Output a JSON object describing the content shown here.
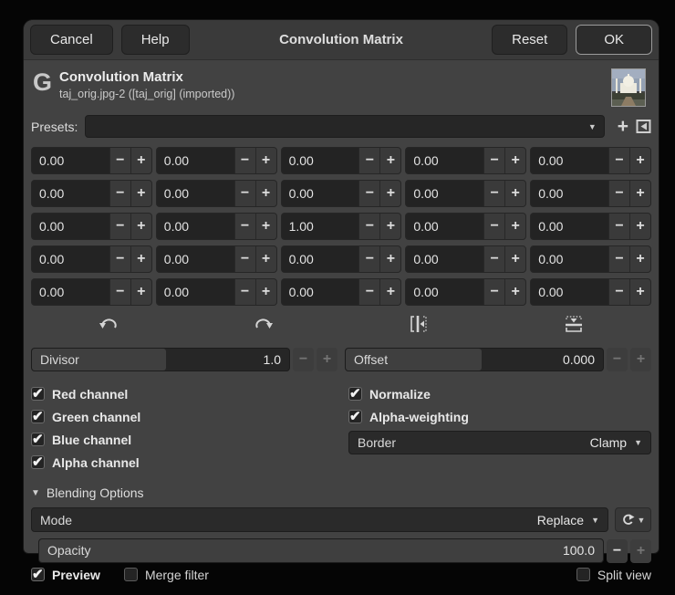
{
  "titlebar": {
    "cancel_label": "Cancel",
    "help_label": "Help",
    "title": "Convolution Matrix",
    "reset_label": "Reset",
    "ok_label": "OK"
  },
  "header": {
    "logo_glyph": "G",
    "title": "Convolution Matrix",
    "subtitle": "taj_orig.jpg-2 ([taj_orig] (imported))",
    "thumbnail": "taj-mahal-preview"
  },
  "presets": {
    "label": "Presets:",
    "value": "",
    "add_button_icon": "plus-icon",
    "add_button_glyph": "+",
    "manage_button_icon": "saved-settings-icon"
  },
  "matrix": {
    "rows": [
      [
        "0.00",
        "0.00",
        "0.00",
        "0.00",
        "0.00"
      ],
      [
        "0.00",
        "0.00",
        "0.00",
        "0.00",
        "0.00"
      ],
      [
        "0.00",
        "0.00",
        "1.00",
        "0.00",
        "0.00"
      ],
      [
        "0.00",
        "0.00",
        "0.00",
        "0.00",
        "0.00"
      ],
      [
        "0.00",
        "0.00",
        "0.00",
        "0.00",
        "0.00"
      ]
    ],
    "minus_glyph": "−",
    "plus_glyph": "+"
  },
  "tools": [
    {
      "name": "rotate-90-ccw"
    },
    {
      "name": "rotate-90-cw"
    },
    {
      "name": "flip-horizontal"
    },
    {
      "name": "flip-vertical"
    }
  ],
  "divisor": {
    "label": "Divisor",
    "value": "1.0",
    "fill_pct": 52,
    "minus_enabled": false,
    "plus_enabled": false
  },
  "offset": {
    "label": "Offset",
    "value": "0.000",
    "fill_pct": 53,
    "minus_enabled": false,
    "plus_enabled": false
  },
  "channels": [
    {
      "label": "Red channel",
      "checked": true
    },
    {
      "label": "Green channel",
      "checked": true
    },
    {
      "label": "Blue channel",
      "checked": true
    },
    {
      "label": "Alpha channel",
      "checked": true
    }
  ],
  "options": [
    {
      "label": "Normalize",
      "checked": true
    },
    {
      "label": "Alpha-weighting",
      "checked": true
    }
  ],
  "border": {
    "label": "Border",
    "value": "Clamp"
  },
  "blending": {
    "header": "Blending Options",
    "expanded": true,
    "mode_label": "Mode",
    "mode_value": "Replace",
    "reset_icon": "reset-blend-mode-icon",
    "opacity_label": "Opacity",
    "opacity_value": "100.0",
    "opacity_fill_pct": 100,
    "opacity_minus_enabled": true,
    "opacity_plus_enabled": false
  },
  "footer": [
    {
      "label": "Preview",
      "checked": true,
      "bold": true
    },
    {
      "label": "Merge filter",
      "checked": false,
      "bold": false
    },
    {
      "label": "Split view",
      "checked": false,
      "bold": false,
      "align": "right"
    }
  ],
  "colors": {
    "window_bg": "#424242",
    "titlebar_bg": "#3a3a3a",
    "entry_bg": "#232323",
    "button_bg": "#2c2c2c",
    "slider_fill": "#3f3f3f",
    "text": "#e2e2e2",
    "ok_focus_border": "#9b9b9b"
  }
}
